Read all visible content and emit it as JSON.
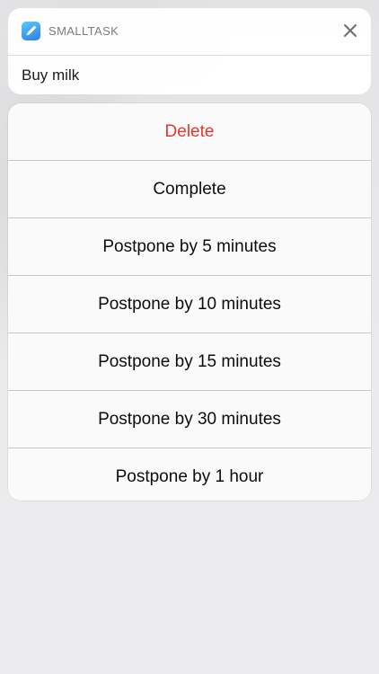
{
  "notification": {
    "app_name": "SMALLTASK",
    "icon": "pencil-app-icon",
    "body": "Buy milk",
    "close_icon": "close-icon"
  },
  "actions": [
    {
      "label": "Delete",
      "style": "destructive"
    },
    {
      "label": "Complete"
    },
    {
      "label": "Postpone by 5 minutes"
    },
    {
      "label": "Postpone by 10 minutes"
    },
    {
      "label": "Postpone by 15 minutes"
    },
    {
      "label": "Postpone by 30 minutes"
    },
    {
      "label": "Postpone by 1 hour"
    }
  ],
  "colors": {
    "destructive": "#e8372c",
    "app_icon_gradient": [
      "#5ac8fa",
      "#2f7fe0"
    ]
  }
}
